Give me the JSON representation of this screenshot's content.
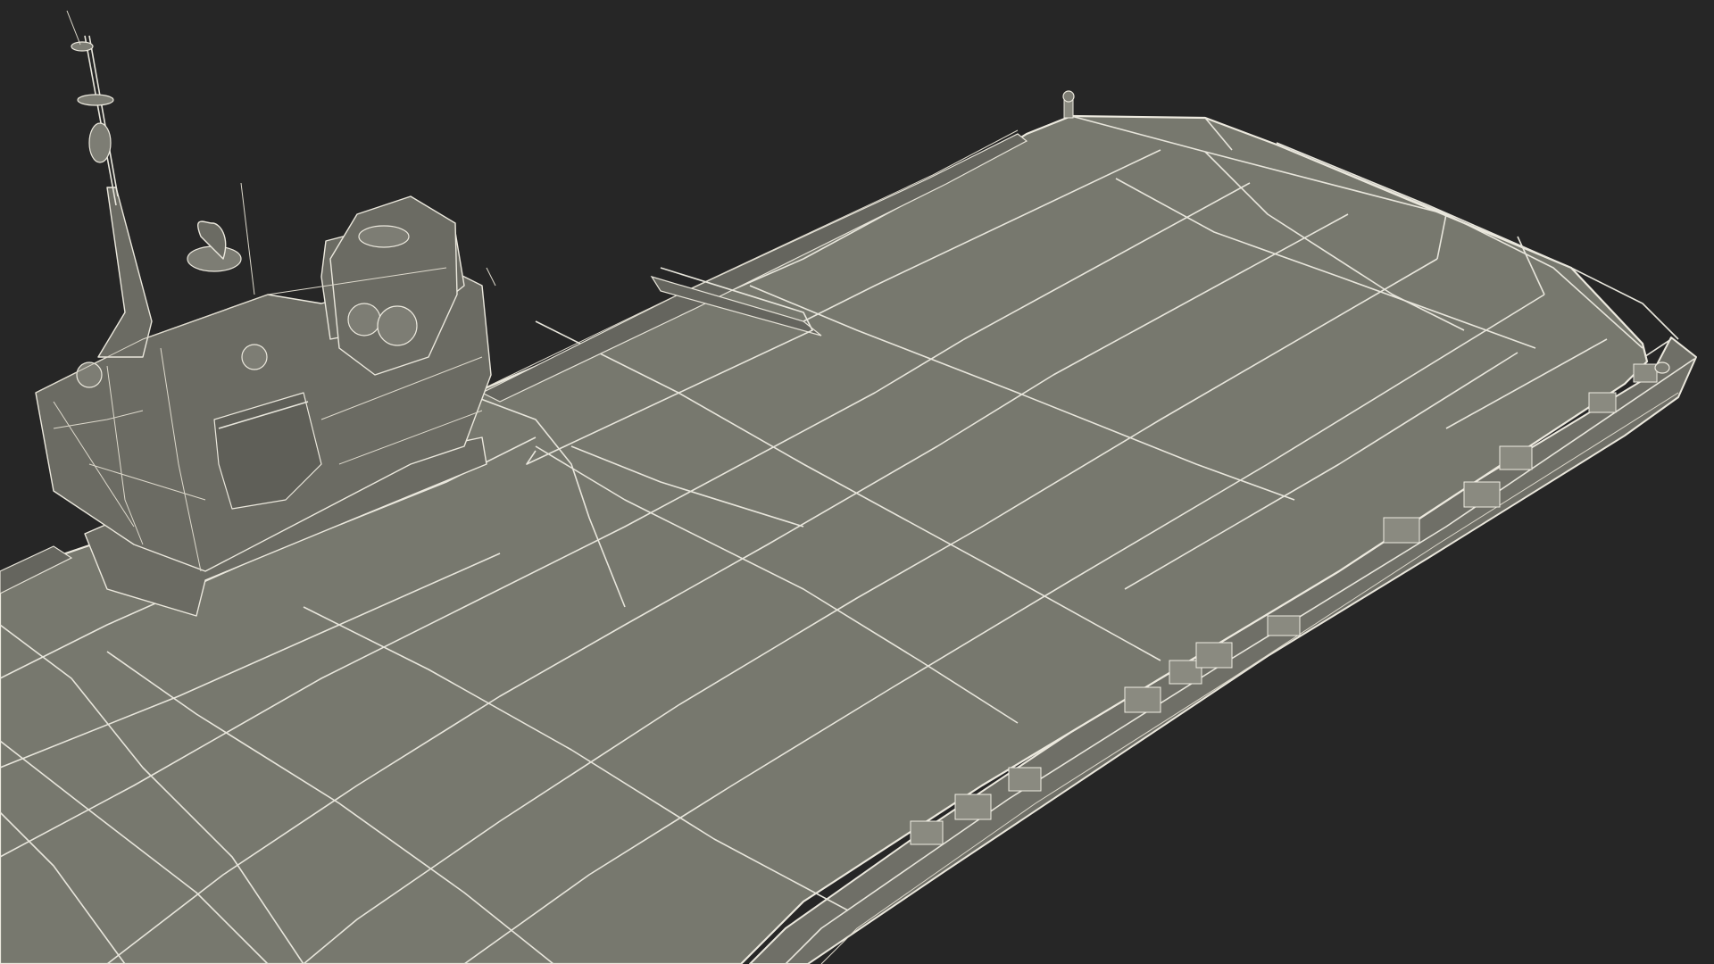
{
  "scene": {
    "background_color": "#262626",
    "deck_color": "#77786e",
    "hull_color": "#6f6f67",
    "wire_color": "#e8e6dc",
    "subject": "aircraft-carrier-wireframe-model"
  }
}
